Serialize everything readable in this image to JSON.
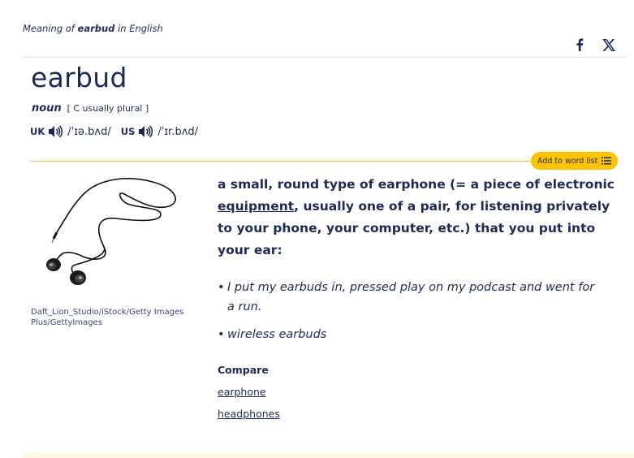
{
  "header": {
    "meaning_prefix": "Meaning of",
    "meaning_word": "earbud",
    "meaning_suffix": "in English"
  },
  "share": {
    "facebook_label": "f",
    "x_label": "𝕏"
  },
  "entry": {
    "headword": "earbud",
    "pos": "noun",
    "grammar": "[ C usually plural ]",
    "pron": [
      {
        "region": "UK",
        "ipa": "/ˈɪə.bʌd/"
      },
      {
        "region": "US",
        "ipa": "/ˈɪr.bʌd/"
      }
    ]
  },
  "word_list_button": "Add to word list",
  "image": {
    "credit": "Daft_Lion_Studio/iStock/Getty Images Plus/GettyImages"
  },
  "definition": {
    "part1": "a small, round type of earphone (= a piece of electronic ",
    "link": "equipment",
    "part2": ", usually one of a pair, for listening privately to your phone, your computer, etc.) that you put into your ear:"
  },
  "examples": [
    "I put my earbuds in, pressed play on my podcast and went for a run.",
    "wireless earbuds"
  ],
  "compare": {
    "heading": "Compare",
    "links": [
      "earphone",
      "headphones"
    ]
  },
  "colors": {
    "brand_navy": "#1d2a57",
    "accent_yellow": "#fec400"
  }
}
